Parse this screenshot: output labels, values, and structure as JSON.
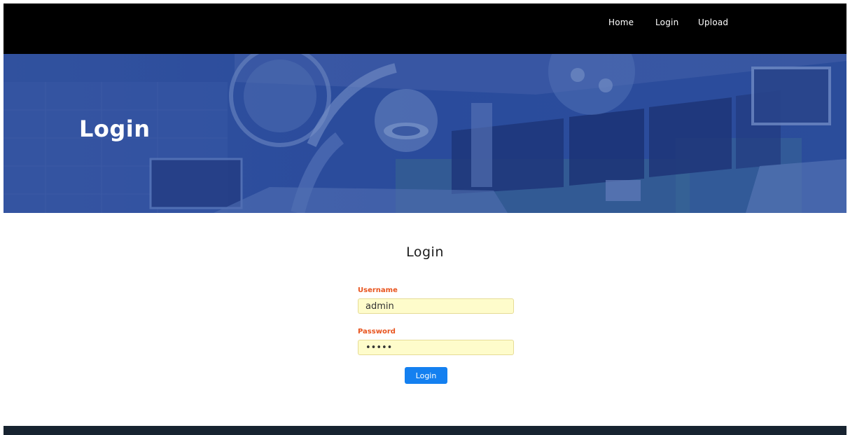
{
  "nav": {
    "items": [
      {
        "label": "Home"
      },
      {
        "label": "Login"
      },
      {
        "label": "Upload"
      }
    ]
  },
  "hero": {
    "title": "Login"
  },
  "form": {
    "title": "Login",
    "username": {
      "label": "Username",
      "value": "admin"
    },
    "password": {
      "label": "Password",
      "value": "admin"
    },
    "submit_label": "Login"
  },
  "colors": {
    "nav_bg": "#000000",
    "hero_overlay": "#2c4ea0",
    "label": "#e8541e",
    "input_bg": "#fefccb",
    "button": "#1480f0",
    "footer": "#172330"
  }
}
